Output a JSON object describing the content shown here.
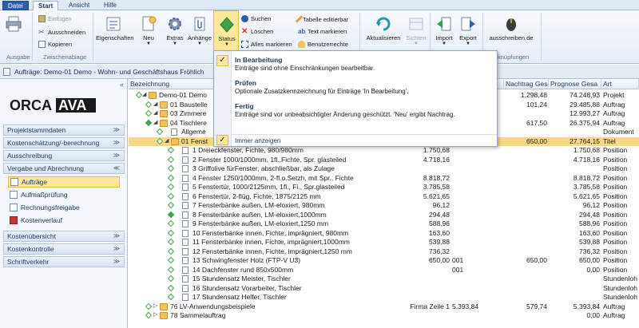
{
  "ribbon_tabs": [
    "Datei",
    "Start",
    "Ansicht",
    "Hilfe"
  ],
  "ribbon": {
    "einfuegen": "Einfügen",
    "ausschneiden": "Ausschneiden",
    "kopieren": "Kopieren",
    "eigenschaften": "Eigenschaften",
    "neu": "Neu",
    "extras": "Extras",
    "anhaenge": "Anhänge",
    "status": "Status",
    "suchen": "Suchen",
    "loeschen": "Löschen",
    "alles_markieren": "Alles markieren",
    "tabelle_editierbar": "Tabelle editierbar",
    "text_markieren": "Text markieren",
    "benutzerrechte": "Benutzerrechte",
    "aktualisieren": "Aktualisieren",
    "sichten": "Sichten",
    "import": "Import",
    "export": "Export",
    "ausschreiben": "ausschreiben.de",
    "group_ausgabe": "Ausgabe",
    "group_zwischenablage": "Zwischenablage",
    "group_verknuepfungen": "knüpfungen"
  },
  "window_title": "Aufträge: Demo-01 Demo - Wohn- und Geschäftshaus Fröhlich",
  "leftnav": {
    "logo": "ORCA AVA",
    "sections": [
      {
        "label": "Projektstammdaten",
        "chev": "≫"
      },
      {
        "label": "Kostenschätzung/-berechnung",
        "chev": "≫"
      },
      {
        "label": "Ausschreibung",
        "chev": "≫"
      },
      {
        "label": "Vergabe und Abrechnung",
        "chev": "≪"
      }
    ],
    "items": [
      "Aufträge",
      "Aufmaßprüfung",
      "Rechnungsfreigabe",
      "Kostenverlauf"
    ],
    "sections2": [
      {
        "label": "Kostenübersicht",
        "chev": "≫"
      },
      {
        "label": "Kostenkontrolle",
        "chev": "≫"
      },
      {
        "label": "Schriftverkehr",
        "chev": "≫"
      }
    ]
  },
  "grid": {
    "headers": [
      "Bezeichnung",
      "Nachtrag Gesa",
      "Prognose Gesa",
      "Art"
    ],
    "rows": [
      {
        "level": 0,
        "kind": "folder",
        "text": "Demo-01 Demo",
        "c1": "",
        "c2": "",
        "n1": "1.298,48",
        "n2": "",
        "n3": "74.248,93",
        "art": "Projekt"
      },
      {
        "level": 1,
        "kind": "folder",
        "text": "01 Baustelle",
        "c1": "",
        "c2": "",
        "n1": "101,24",
        "n2": "",
        "n3": "29.485,88",
        "art": "Auftrag"
      },
      {
        "level": 1,
        "kind": "folder",
        "text": "03 Zimmere",
        "c1": "",
        "c2": "",
        "n1": "",
        "n2": "",
        "n3": "12.993,27",
        "art": "Auftrag"
      },
      {
        "level": 1,
        "kind": "folder",
        "text": "04 Tischlere",
        "c1": "",
        "c2": "",
        "n1": "617,50",
        "n2": "",
        "n3": "26.375,94",
        "art": "Auftrag"
      },
      {
        "level": 2,
        "kind": "pos",
        "text": "Allgeme",
        "c1": "",
        "c2": "",
        "n1": "",
        "n2": "",
        "n3": "",
        "art": "Dokument"
      },
      {
        "level": 2,
        "kind": "folder",
        "text": "01 Fenst",
        "c1": "",
        "c2": "",
        "n1": "650,00",
        "n2": "",
        "n3": "27.764,15",
        "art": "Titel",
        "sel": true
      },
      {
        "level": 3,
        "kind": "pos",
        "text": "1 Dreieckfenster, Fichte, 980/980mm",
        "c1": "1.750,68",
        "c2": "",
        "n1": "",
        "n2": "",
        "n3": "1.750,68",
        "art": "Position"
      },
      {
        "level": 3,
        "kind": "pos",
        "text": "2 Fenster 1000/1000mm, 1fl.,Fichte, Spr. glasteiled",
        "c1": "4.718,16",
        "c2": "",
        "n1": "",
        "n2": "",
        "n3": "4.718,16",
        "art": "Position"
      },
      {
        "level": 3,
        "kind": "pos",
        "text": "3 Griffolive fürFenster, abschließbar, als Zulage",
        "c1": "",
        "c2": "",
        "n1": "",
        "n2": "",
        "n3": "",
        "art": "Position"
      },
      {
        "level": 3,
        "kind": "pos",
        "text": "4 Fenster 1250/1000mm, 2-fl.o.Setzh, mit Spr., Fichte",
        "c1": "8.818,72",
        "c2": "",
        "n1": "",
        "n2": "",
        "n3": "8.818,72",
        "art": "Position"
      },
      {
        "level": 3,
        "kind": "pos",
        "text": "5 Fenstertür, 1000/2125mm, 1fl., Fi., Spr.glasteiled",
        "c1": "3.785,58",
        "c2": "",
        "n1": "",
        "n2": "",
        "n3": "3.785,58",
        "art": "Position"
      },
      {
        "level": 3,
        "kind": "pos",
        "text": "6 Fenstertür, 2-flüg, Fichte, 1875/2125 mm",
        "c1": "5.621,65",
        "c2": "",
        "n1": "",
        "n2": "",
        "n3": "5.621,65",
        "art": "Position"
      },
      {
        "level": 3,
        "kind": "pos",
        "text": "7 Fensterbänke außen, LM-eloxiert, 980mm",
        "c1": "96,12",
        "c2": "",
        "n1": "",
        "n2": "",
        "n3": "96,12",
        "art": "Position"
      },
      {
        "level": 3,
        "kind": "pos",
        "text": "8 Fensterbänke außen, LM-eloxiert,1000mm",
        "c1": "294,48",
        "c2": "",
        "n1": "",
        "n2": "",
        "n3": "294,48",
        "art": "Position",
        "filled": true
      },
      {
        "level": 3,
        "kind": "pos",
        "text": "9 Fensterbänke außen, LM-eloxiert,1250 mm",
        "c1": "588,96",
        "c2": "",
        "n1": "",
        "n2": "",
        "n3": "588,96",
        "art": "Position"
      },
      {
        "level": 3,
        "kind": "pos",
        "text": "10 Fensterbänke innen, Fichte, imprägniert, 980mm",
        "c1": "163,60",
        "c2": "",
        "n1": "",
        "n2": "",
        "n3": "163,60",
        "art": "Position"
      },
      {
        "level": 3,
        "kind": "pos",
        "text": "11 Fensterbänke innen, Fichte, imprägniert,1000mm",
        "c1": "539,88",
        "c2": "",
        "n1": "",
        "n2": "",
        "n3": "539,88",
        "art": "Position"
      },
      {
        "level": 3,
        "kind": "pos",
        "text": "12 Fensterbänke innen, Fichte, imprägniert,1250 mm",
        "c1": "736,32",
        "c2": "",
        "n1": "",
        "n2": "",
        "n3": "736,32",
        "art": "Position"
      },
      {
        "level": 3,
        "kind": "pos",
        "text": "13 Schwingfenster Holz (FTP-V U3)",
        "c1": "650,00",
        "c2": "001",
        "n1": "650,00",
        "n2": "",
        "n3": "650,00",
        "art": "Position"
      },
      {
        "level": 3,
        "kind": "pos",
        "text": "14 Dachfenster rund 850x500mm",
        "c1": "",
        "c2": "001",
        "n1": "",
        "n2": "",
        "n3": "0,00",
        "art": "Position"
      },
      {
        "level": 3,
        "kind": "pos",
        "text": "15 Stundensatz Meister, Tischler",
        "c1": "",
        "c2": "",
        "n1": "",
        "n2": "",
        "n3": "",
        "art": "Stundenloh"
      },
      {
        "level": 3,
        "kind": "pos",
        "text": "16 Stundensatz Vorarbeiter, Tischler",
        "c1": "",
        "c2": "",
        "n1": "",
        "n2": "",
        "n3": "",
        "art": "Stundenloh"
      },
      {
        "level": 3,
        "kind": "pos",
        "text": "17 Stundensatz Helfer, Tischler",
        "c1": "",
        "c2": "",
        "n1": "",
        "n2": "",
        "n3": "",
        "art": "Stundenloh"
      },
      {
        "level": 1,
        "kind": "folder",
        "text": "76 LV-Anwendungsbeispiele",
        "c1": "Firma Zeile 1",
        "c2": "5.393,84",
        "n1": "579,74",
        "n2": "",
        "n3": "5.393,84",
        "art": "Auftrag"
      },
      {
        "level": 1,
        "kind": "folder",
        "text": "78 Sammelauftrag",
        "c1": "",
        "c2": "",
        "n1": "",
        "n2": "",
        "n3": "0,00",
        "art": "Auftrag"
      }
    ]
  },
  "status_popup": {
    "items": [
      {
        "title": "In Bearbeitung",
        "desc": "Einträge sind ohne Einschränkungen bearbeitbar.",
        "checked": true
      },
      {
        "title": "Prüfen",
        "desc": "Optionale Zusatzkennzeichnung für Einträge 'In Bearbeitung'.",
        "checked": false
      },
      {
        "title": "Fertig",
        "desc": "Einträge sind vor unbeabsichtigter Änderung geschützt. 'Neu' ergibt Nachtrag.",
        "checked": false
      }
    ],
    "footer": "Immer anzeigen",
    "footer_checked": true
  },
  "colors": {
    "accent": "#fde89b",
    "selection_row": "#fbd887",
    "folder": "#f2c25b",
    "ribbon_blue": "#2a5fa8"
  }
}
